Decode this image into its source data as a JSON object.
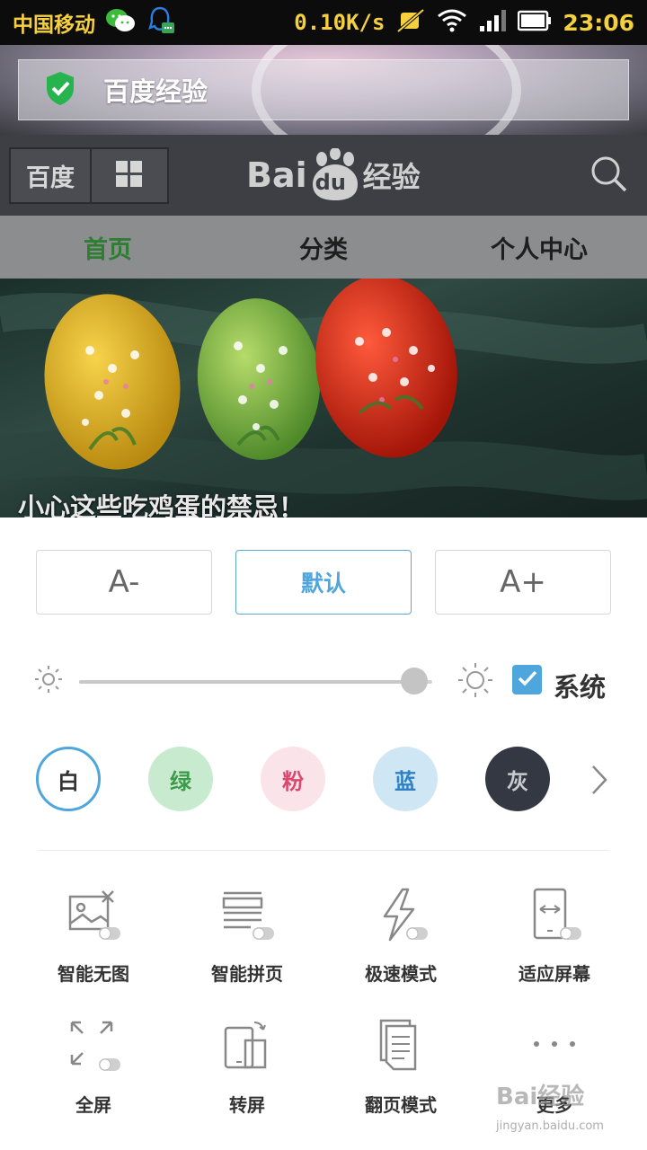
{
  "status_bar": {
    "carrier": "中国移动",
    "speed": "0.10K/s",
    "time": "23:06"
  },
  "banner": {
    "title": "百度经验"
  },
  "header": {
    "home_label": "百度",
    "logo_text_prefix": "Bai",
    "logo_text_du": "du",
    "logo_text_suffix": "经验"
  },
  "nav": {
    "tabs": [
      {
        "label": "首页",
        "active": true
      },
      {
        "label": "分类",
        "active": false
      },
      {
        "label": "个人中心",
        "active": false
      }
    ]
  },
  "hero": {
    "caption": "小心这些吃鸡蛋的禁忌！"
  },
  "font_size": {
    "decrease_label": "A-",
    "default_label": "默认",
    "increase_label": "A+",
    "selected": "default"
  },
  "brightness": {
    "level_fraction": 0.95,
    "system_label": "系统",
    "system_checked": true
  },
  "themes": [
    {
      "label": "白",
      "bg": "#ffffff",
      "fg": "#333333",
      "selected": true
    },
    {
      "label": "绿",
      "bg": "#c8ebcf",
      "fg": "#3d9a4a",
      "selected": false
    },
    {
      "label": "粉",
      "bg": "#fbe3ea",
      "fg": "#d9486f",
      "selected": false
    },
    {
      "label": "蓝",
      "bg": "#cfe6f4",
      "fg": "#2f80c4",
      "selected": false
    },
    {
      "label": "灰",
      "bg": "#333842",
      "fg": "#c9cbd0",
      "selected": false
    }
  ],
  "functions": [
    {
      "label": "智能无图",
      "icon": "no-image-icon"
    },
    {
      "label": "智能拼页",
      "icon": "page-merge-icon"
    },
    {
      "label": "极速模式",
      "icon": "lightning-icon"
    },
    {
      "label": "适应屏幕",
      "icon": "fit-screen-icon"
    },
    {
      "label": "全屏",
      "icon": "fullscreen-icon"
    },
    {
      "label": "转屏",
      "icon": "rotate-screen-icon"
    },
    {
      "label": "翻页模式",
      "icon": "page-turn-icon"
    },
    {
      "label": "更多",
      "icon": "more-icon"
    }
  ],
  "watermark": {
    "text": "Bai经验",
    "url": "jingyan.baidu.com"
  },
  "colors": {
    "accent_blue": "#4ea6dc",
    "active_tab_green": "#2e7d32",
    "status_yellow": "#f4d03f"
  }
}
